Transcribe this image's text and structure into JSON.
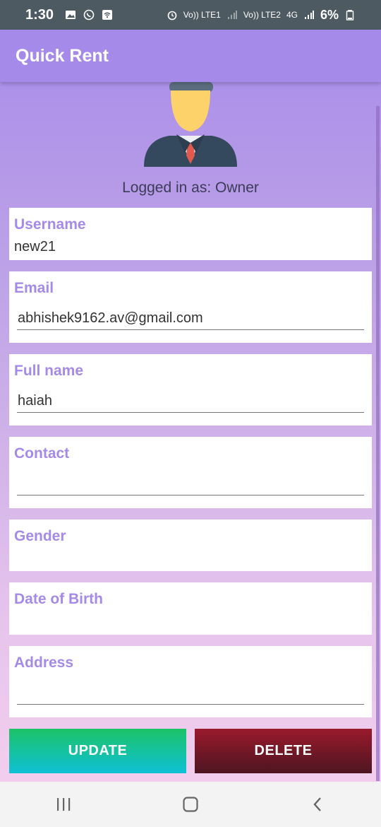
{
  "status_bar": {
    "time": "1:30",
    "sim1_label": "Vo)) LTE1",
    "sim2_label": "Vo)) LTE2",
    "network": "4G",
    "battery": "6%"
  },
  "app_bar": {
    "title": "Quick Rent"
  },
  "profile": {
    "logged_in_text": "Logged in as: Owner"
  },
  "fields": {
    "username": {
      "label": "Username",
      "value": "new21"
    },
    "email": {
      "label": "Email",
      "value": "abhishek9162.av@gmail.com"
    },
    "full_name": {
      "label": "Full name",
      "value": "haiah"
    },
    "contact": {
      "label": "Contact",
      "value": ""
    },
    "gender": {
      "label": "Gender",
      "value": ""
    },
    "dob": {
      "label": "Date of Birth",
      "value": ""
    },
    "address": {
      "label": "Address",
      "value": ""
    }
  },
  "buttons": {
    "update": "UPDATE",
    "delete": "DELETE"
  },
  "colors": {
    "accent": "#a58ae9",
    "update_start": "#1cc267",
    "update_end": "#0ec1d6",
    "delete_start": "#9a1a2c",
    "delete_end": "#4d1521"
  },
  "icons": [
    "image-icon",
    "whatsapp-icon",
    "wifi-icon",
    "alarm-icon",
    "signal-icon",
    "battery-icon",
    "avatar",
    "recents-icon",
    "home-icon",
    "back-icon"
  ]
}
